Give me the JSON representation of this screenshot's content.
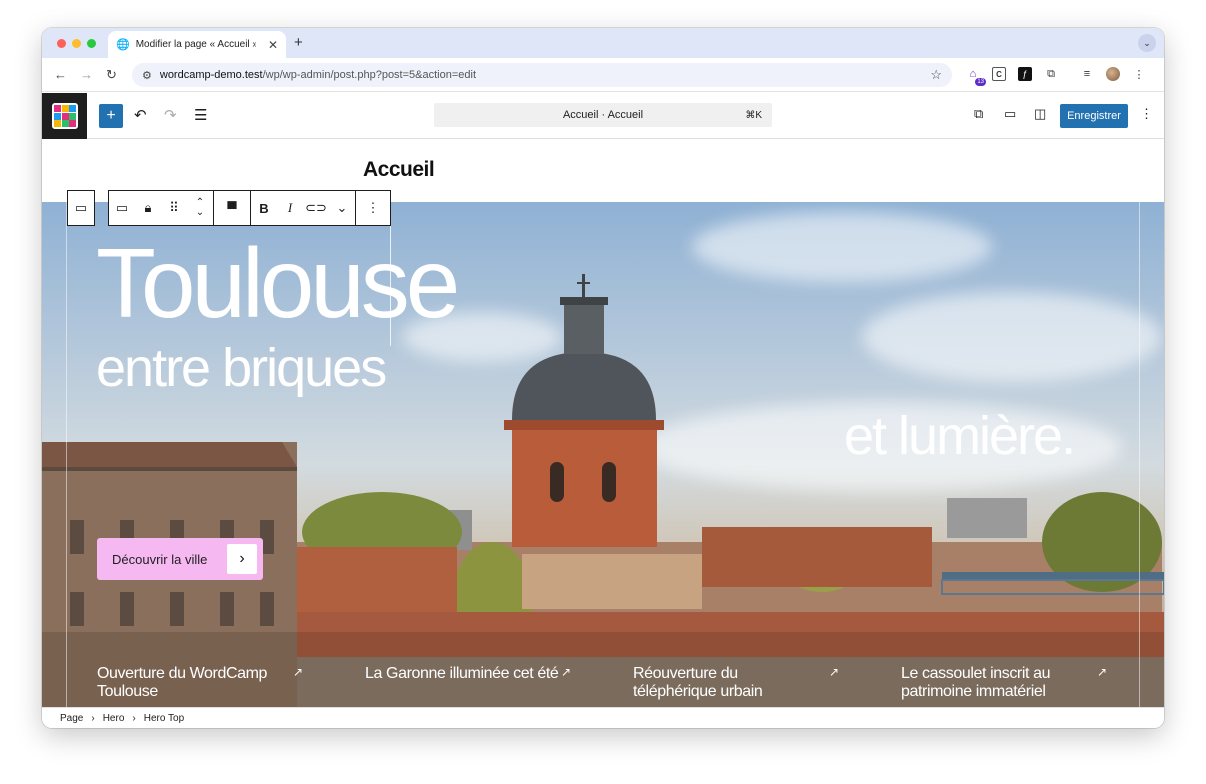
{
  "browser": {
    "tab_title": "Modifier la page « Accueil » ‹",
    "tab_close": "✕",
    "new_tab": "+",
    "tab_menu": "⌄",
    "url_host": "wordcamp-demo.test",
    "url_path": "/wp/wp-admin/post.php?post=5&action=edit",
    "ext_badge": "13",
    "ext_c_label": "C"
  },
  "editor": {
    "command_title": "Accueil · Accueil",
    "command_shortcut": "⌘K",
    "save_label": "Enregistrer"
  },
  "page": {
    "heading": "Accueil"
  },
  "hero": {
    "title_line1": "Toulouse",
    "title_line2": "entre briques",
    "title_line3": "et lumière.",
    "cta_label": "Découvrir la ville",
    "news": [
      {
        "title": "Ouverture du WordCamp Toulouse"
      },
      {
        "title": "La Garonne illuminée cet été"
      },
      {
        "title": "Réouverture du téléphérique urbain"
      },
      {
        "title": "Le cassoulet inscrit au patrimoine immatériel"
      }
    ]
  },
  "breadcrumb": {
    "items": [
      "Page",
      "Hero",
      "Hero Top"
    ]
  },
  "colors": {
    "wp_blue": "#2271b1",
    "cta_pink": "#f5b8f0",
    "tabbar": "#dfe6f7"
  }
}
